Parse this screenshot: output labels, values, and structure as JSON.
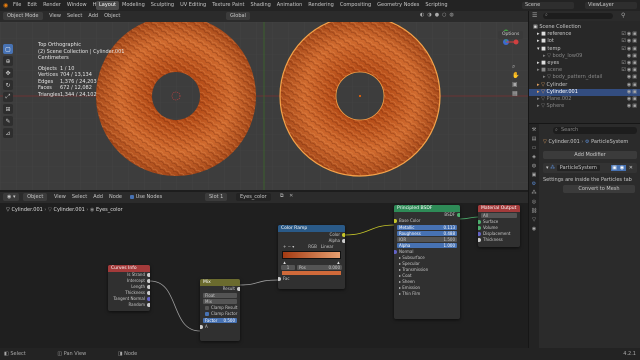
{
  "topbar": {
    "menus": [
      "File",
      "Edit",
      "Render",
      "Window",
      "Help"
    ],
    "workspaces": [
      "Layout",
      "Modeling",
      "Sculpting",
      "UV Editing",
      "Texture Paint",
      "Shading",
      "Animation",
      "Rendering",
      "Compositing",
      "Geometry Nodes",
      "Scripting"
    ],
    "scene_label": "Scene",
    "viewlayer_label": "ViewLayer"
  },
  "viewport": {
    "mode": "Object Mode",
    "menus": [
      "View",
      "Select",
      "Add",
      "Object"
    ],
    "transform": "Global",
    "options": "Options",
    "overlay_title": "Top Orthographic",
    "overlay_collection": "(2) Scene Collection | Cylinder.001",
    "overlay_units": "Centimeters",
    "stats": [
      {
        "label": "Objects",
        "value": "1 / 10"
      },
      {
        "label": "Vertices",
        "value": "704 / 13,134"
      },
      {
        "label": "Edges",
        "value": "1,376 / 24,203"
      },
      {
        "label": "Faces",
        "value": "672 / 12,082"
      },
      {
        "label": "Triangles",
        "value": "1,344 / 24,102"
      }
    ]
  },
  "outliner": {
    "search_placeholder": "",
    "items": [
      {
        "label": "Scene Collection",
        "sel": false
      },
      {
        "label": "reference",
        "sel": false
      },
      {
        "label": "lot",
        "sel": false
      },
      {
        "label": "temp",
        "sel": false
      },
      {
        "label": "body_low09",
        "sel": false
      },
      {
        "label": "eyes",
        "sel": false
      },
      {
        "label": "scene",
        "sel": false
      },
      {
        "label": "body_pattern_detail",
        "sel": false
      },
      {
        "label": "Cylinder",
        "sel": false
      },
      {
        "label": "Cylinder.001",
        "sel": true
      },
      {
        "label": "Plane.002",
        "sel": false
      },
      {
        "label": "Sphere",
        "sel": false
      }
    ]
  },
  "properties": {
    "search_placeholder": "Search",
    "object_name": "Cylinder.001",
    "modifier_name": "ParticleSystem",
    "add_modifier": "Add Modifier",
    "particle_system_name": "ParticleSystem",
    "info_text": "Settings are inside the Particles tab",
    "convert_button": "Convert to Mesh"
  },
  "node_header": {
    "editor": "Object",
    "menus": [
      "View",
      "Select",
      "Add",
      "Node"
    ],
    "use_nodes": "Use Nodes",
    "slot": "Slot 1",
    "material": "Eyes_color",
    "breadcrumbs": [
      "Cylinder.001",
      "Cylinder.001",
      "Eyes_color"
    ]
  },
  "nodes": {
    "curves_info": {
      "title": "Curves Info",
      "outputs": [
        "Is Strand",
        "Intercept",
        "Length",
        "Thickness",
        "Tangent Normal",
        "Random"
      ]
    },
    "mix": {
      "title": "Mix",
      "output": "Result",
      "type": "Float",
      "clamp_result": "Clamp Result",
      "clamp_factor": "Clamp Factor",
      "factor_label": "Factor",
      "factor_value": "0.500",
      "inputs": [
        "A",
        "B"
      ]
    },
    "color_ramp": {
      "title": "Color Ramp",
      "outputs": [
        "Color",
        "Alpha"
      ],
      "mode": "RGB",
      "interp": "Linear",
      "stop_index": "1",
      "pos_label": "Pos",
      "pos_value": "0.000",
      "input": "Fac"
    },
    "bsdf": {
      "title": "Principled BSDF",
      "output": "BSDF",
      "rows": [
        "Base Color"
      ],
      "fields": [
        {
          "label": "Metallic",
          "value": "0.113"
        },
        {
          "label": "Roughness",
          "value": "0.488"
        },
        {
          "label": "IOR",
          "value": "1.500"
        },
        {
          "label": "Alpha",
          "value": "1.000"
        }
      ],
      "more": [
        "Normal",
        "Subsurface",
        "Specular",
        "Transmission",
        "Coat",
        "Sheen",
        "Emission",
        "Thin Film"
      ]
    },
    "output": {
      "title": "Material Output",
      "target": "All",
      "inputs": [
        "Surface",
        "Volume",
        "Displacement",
        "Thickness"
      ]
    }
  },
  "statusbar": {
    "items": [
      "Select",
      "Pan View",
      "Node"
    ],
    "version": "4.2.1"
  },
  "colors": {
    "accent": "#4772b3",
    "iris": "#c85a22",
    "selected_outline": "#f5a34a",
    "bsdf_header": "#2e8b57",
    "output_header": "#a33a3a",
    "ramp_header": "#2a5a88",
    "curves_header": "#a33a3a",
    "mix_header": "#6b6b2e"
  }
}
